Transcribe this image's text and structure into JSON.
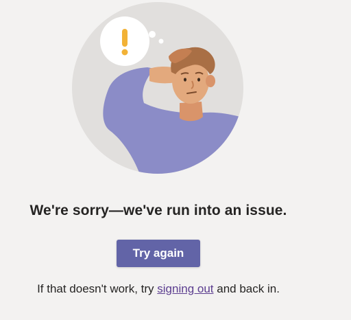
{
  "error": {
    "title": "We're sorry—we've run into an issue.",
    "try_again_label": "Try again",
    "help_prefix": "If that doesn't work, try ",
    "help_link": "signing out",
    "help_suffix": " and back in."
  },
  "illustration": {
    "icon": "confused-person-illustration",
    "bubble_icon": "exclamation-icon"
  },
  "colors": {
    "background": "#f3f2f1",
    "accent": "#6264a7",
    "link": "#5b3d8f",
    "circle": "#e1dfdd",
    "shirt": "#8b8cc7",
    "skin": "#e3a97d",
    "hair": "#a96f45",
    "exclamation": "#f2b236"
  }
}
